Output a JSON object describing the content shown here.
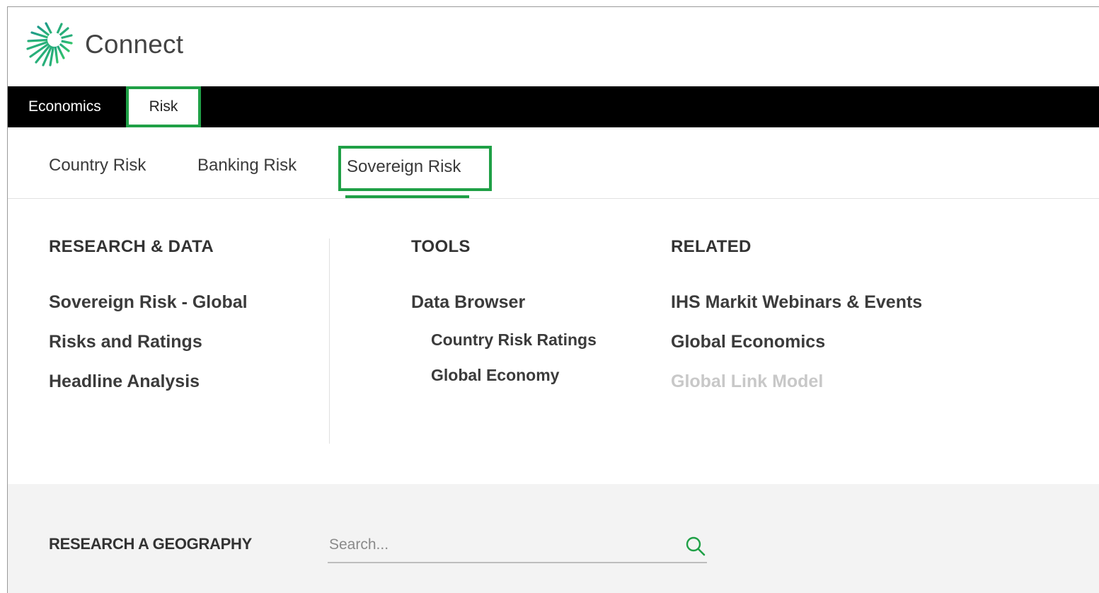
{
  "app": {
    "title": "Connect"
  },
  "top_nav": {
    "items": [
      {
        "label": "Economics"
      },
      {
        "label": "Risk"
      }
    ]
  },
  "sub_nav": {
    "tabs": [
      {
        "label": "Country Risk"
      },
      {
        "label": "Banking Risk"
      },
      {
        "label": "Sovereign Risk"
      }
    ]
  },
  "research": {
    "heading": "RESEARCH & DATA",
    "links": [
      {
        "label": "Sovereign Risk - Global"
      },
      {
        "label": "Risks and Ratings"
      },
      {
        "label": "Headline Analysis"
      }
    ]
  },
  "tools": {
    "heading": "TOOLS",
    "main_link": "Data Browser",
    "sub_links": [
      {
        "label": "Country Risk Ratings"
      },
      {
        "label": "Global Economy"
      }
    ]
  },
  "related": {
    "heading": "RELATED",
    "links": [
      {
        "label": "IHS Markit Webinars & Events"
      },
      {
        "label": "Global Economics"
      },
      {
        "label": "Global Link Model"
      }
    ]
  },
  "geography": {
    "label": "RESEARCH A GEOGRAPHY",
    "placeholder": "Search..."
  },
  "colors": {
    "accent": "#1fa046",
    "nav_background": "#000000",
    "band_background": "#f3f3f3"
  }
}
